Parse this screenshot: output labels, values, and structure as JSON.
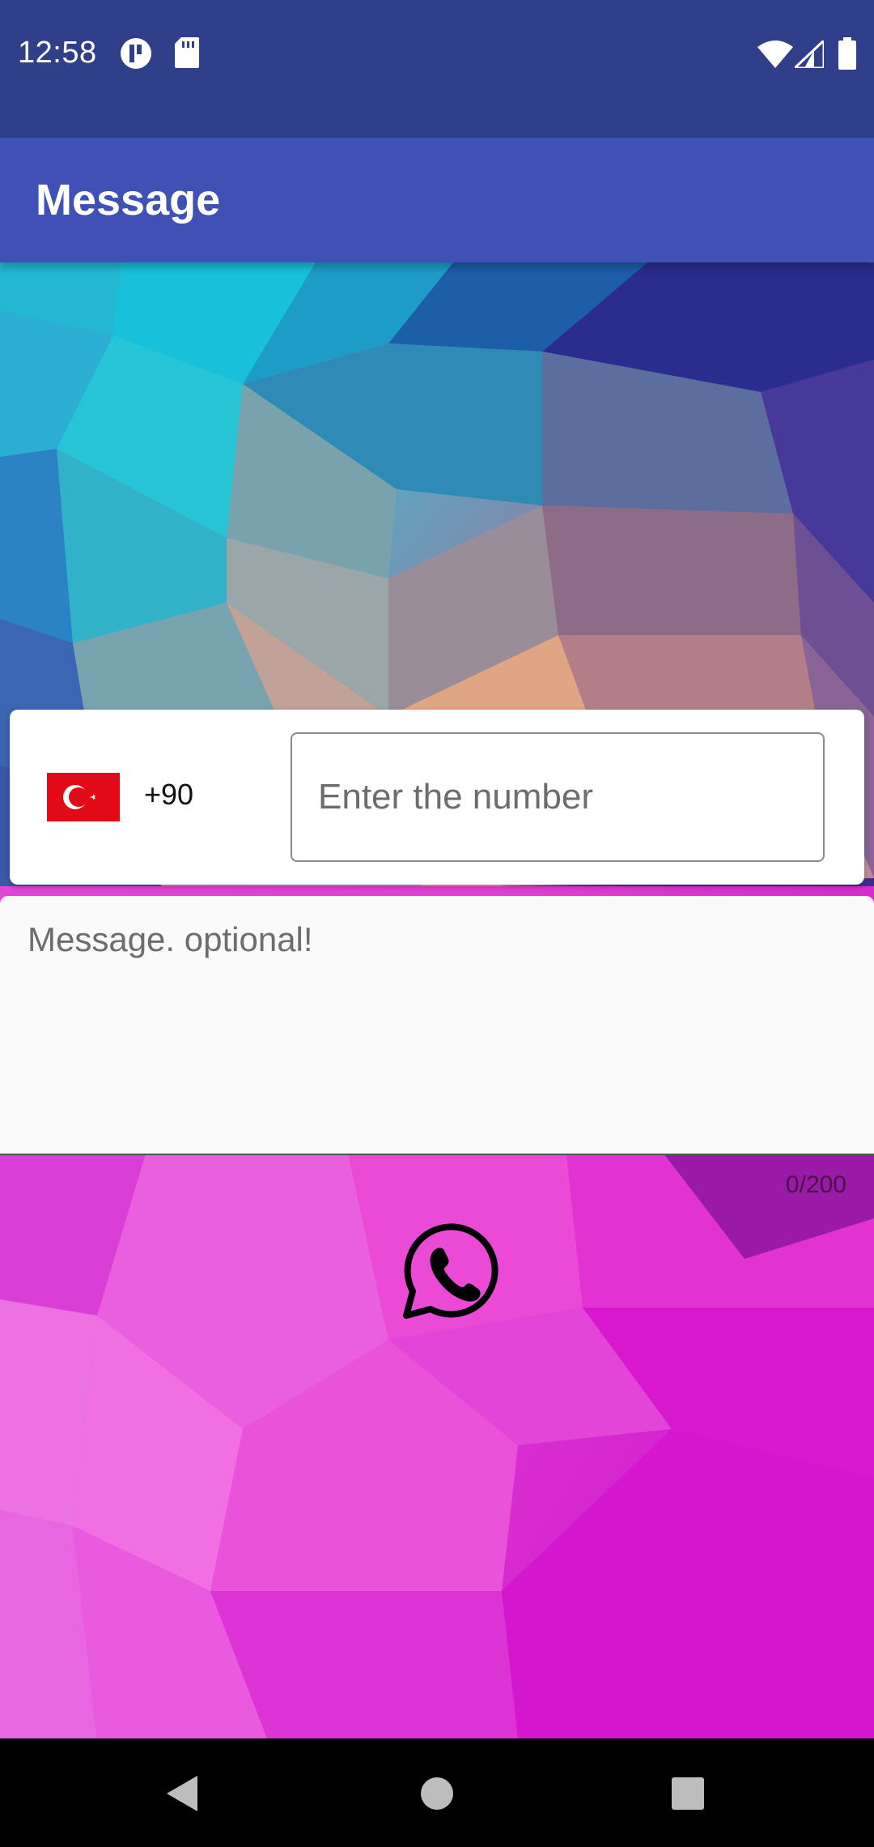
{
  "status_bar": {
    "time": "12:58",
    "icons": [
      "app-notification-icon",
      "sd-card-icon",
      "wifi-icon",
      "signal-icon",
      "battery-icon"
    ]
  },
  "app_bar": {
    "title": "Message",
    "color": "#3f51b5"
  },
  "phone_input": {
    "country_flag": "turkey-flag-icon",
    "country_code": "+90",
    "placeholder": "Enter the number",
    "value": ""
  },
  "message": {
    "placeholder": "Message. optional!",
    "value": "",
    "counter": "0/200"
  },
  "send_button": {
    "icon": "whatsapp-icon"
  },
  "nav_bar": {
    "buttons": [
      "back-icon",
      "home-icon",
      "recents-icon"
    ]
  },
  "colors": {
    "status_bar": "#303f8a",
    "accent": "#3f51b5",
    "flag_red": "#e30a17"
  }
}
